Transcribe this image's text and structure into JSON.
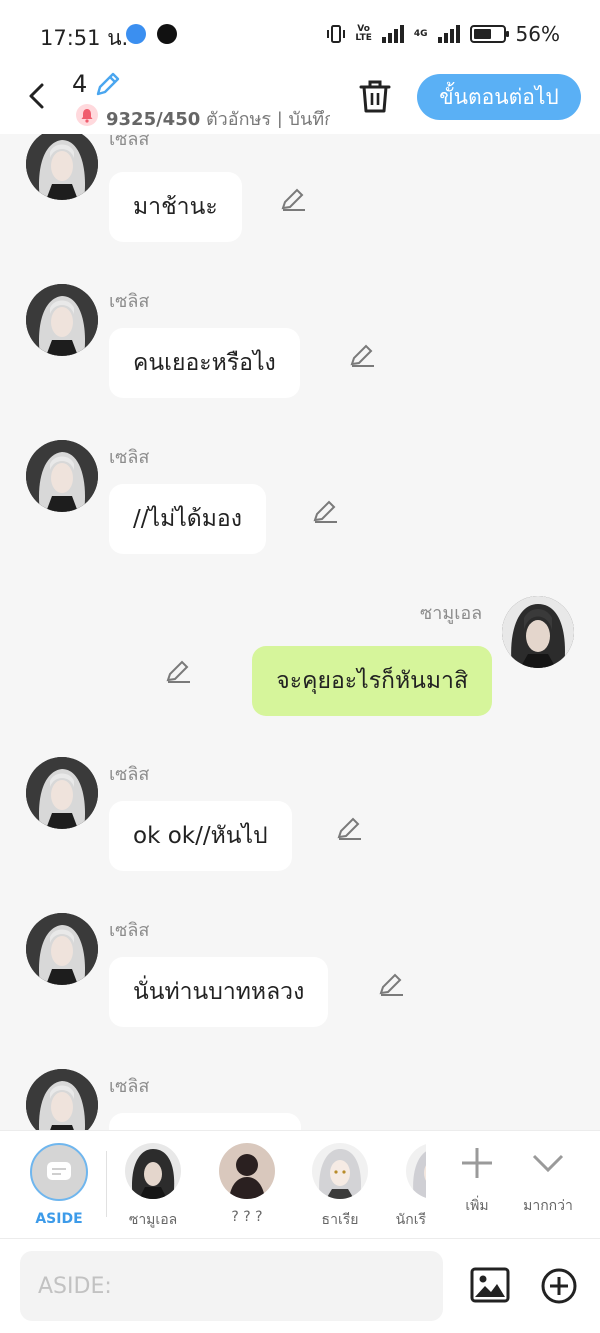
{
  "status": {
    "time": "17:51 น.",
    "battery": "56%",
    "volte_top": "Vo",
    "volte_bottom": "LTE",
    "network": "4G",
    "battery_level": 0.56
  },
  "header": {
    "episode_number": "4",
    "char_count": "9325/450",
    "count_suffix": "ตัวอักษร | บันทึก",
    "next_label": "ขั้นตอนต่อไป"
  },
  "messages": [
    {
      "speaker": "เซลิส",
      "text": "มาช้านะ"
    },
    {
      "speaker": "เซลิส",
      "text": "คนเยอะหรือไง"
    },
    {
      "speaker": "เซลิส",
      "text": "//ไม่ได้มอง"
    },
    {
      "speaker": "ซามูเอล",
      "text": "จะคุยอะไรก็หันมาสิ"
    },
    {
      "speaker": "เซลิส",
      "text": "ok ok//หันไป"
    },
    {
      "speaker": "เซลิส",
      "text": "นั่นท่านบาทหลวง"
    },
    {
      "speaker": "เซลิส",
      "text": ""
    }
  ],
  "characters": {
    "aside": "ASIDE",
    "c1": "ซามูเอล",
    "c2": "? ? ?",
    "c3": "ธาเรีย",
    "c4": "นักเรี",
    "add": "เพิ่ม",
    "more": "มากกว่า"
  },
  "input": {
    "placeholder": "ASIDE:"
  },
  "colors": {
    "accent": "#5ab0f5",
    "own_bubble": "#d6f59b",
    "other_bubble": "#ffffff",
    "aside_label": "#3d9be9"
  },
  "icons": [
    "back-icon",
    "pencil-icon",
    "bell-icon",
    "trash-icon",
    "image-icon",
    "plus-circle-icon",
    "plus-icon",
    "chevron-down-icon"
  ]
}
